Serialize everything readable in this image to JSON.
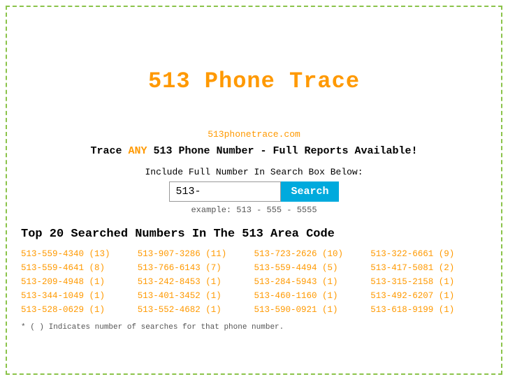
{
  "page": {
    "title": "513 Phone Trace",
    "site_url": "513phonetrace.com",
    "tagline_prefix": "Trace ",
    "tagline_any": "ANY",
    "tagline_suffix": " 513 Phone Number - Full Reports Available!",
    "search_label": "Include Full Number In Search Box Below:",
    "search_placeholder": "513-",
    "search_button_label": "Search",
    "search_example": "example: 513 - 555 - 5555",
    "top20_title": "Top 20 Searched Numbers In The 513 Area Code",
    "footnote": "* ( ) Indicates number of searches for that phone number.",
    "numbers": [
      "513-559-4340 (13)",
      "513-907-3286 (11)",
      "513-723-2626 (10)",
      "513-322-6661 (9)",
      "513-559-4641 (8)",
      "513-766-6143 (7)",
      "513-559-4494 (5)",
      "513-417-5081 (2)",
      "513-209-4948 (1)",
      "513-242-8453 (1)",
      "513-284-5943 (1)",
      "513-315-2158 (1)",
      "513-344-1049 (1)",
      "513-401-3452 (1)",
      "513-460-1160 (1)",
      "513-492-6207 (1)",
      "513-528-0629 (1)",
      "513-552-4682 (1)",
      "513-590-0921 (1)",
      "513-618-9199 (1)"
    ]
  }
}
